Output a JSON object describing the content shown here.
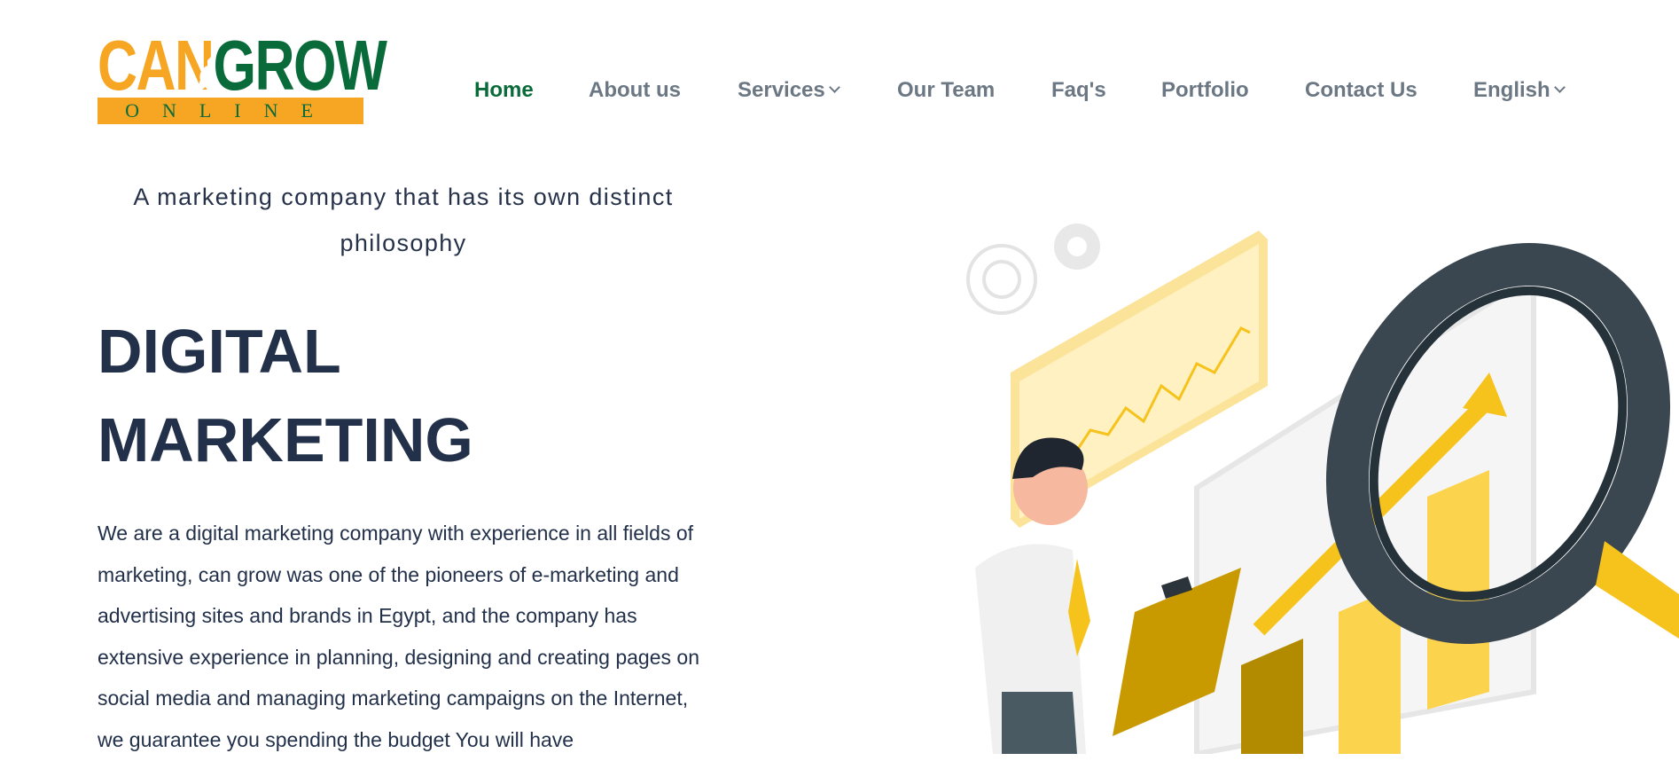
{
  "brand": {
    "logo_top": "CANGROW",
    "logo_part1": "CAN",
    "logo_part2": "GROW",
    "logo_bottom": "ONLINE"
  },
  "nav": {
    "home": "Home",
    "about": "About us",
    "services": "Services",
    "team": "Our Team",
    "faq": "Faq's",
    "portfolio": "Portfolio",
    "contact": "Contact Us",
    "language": "English"
  },
  "hero": {
    "tagline": "A marketing company that has its own distinct philosophy",
    "headline_line1": "DIGITAL",
    "headline_line2": "MARKETING",
    "description": "We are a digital marketing company with experience in all fields of marketing, can grow was one of the pioneers of e-marketing and advertising sites and brands in Egypt, and the company has extensive experience in planning, designing and creating pages on social media and managing marketing campaigns on the Internet, we guarantee you spending the budget You will have"
  },
  "colors": {
    "brand_orange": "#f6a623",
    "brand_green": "#0a6b3a",
    "nav_gray": "#6b7884",
    "heading": "#22304a",
    "illustration_yellow": "#fcd34d",
    "illustration_dark": "#3a4750"
  },
  "icons": {
    "services_dropdown": "chevron-down-icon",
    "language_dropdown": "chevron-down-icon"
  }
}
